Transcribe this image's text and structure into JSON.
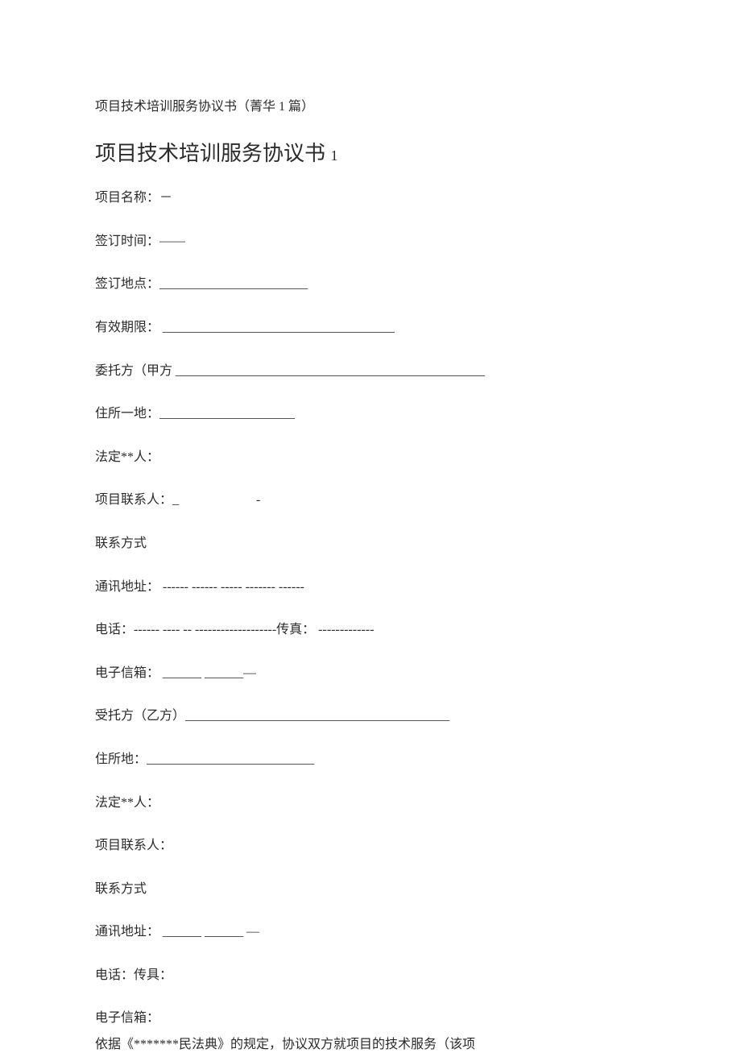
{
  "subtitle": "项目技术培训服务协议书（菁华 1 篇）",
  "title_main": "项目技术培训服务协议书 ",
  "title_num": "1",
  "fields": {
    "project_name": "项目名称：－",
    "sign_time": "签订时间：——",
    "sign_place": "签订地点：_______________________",
    "valid_period": "有效期限： ____________________________________",
    "party_a": "委托方（甲方 ________________________________________________",
    "residence_a": "住所一地：_____________________",
    "legal_a": "法定**人：",
    "contact_a": "项目联系人：_　　　　　　-",
    "contact_method_a": "联系方式",
    "address_a": "通讯地址： ------ ------ ----- ------- ------",
    "phone_a": "电话：------ ---- -- -------------------传真： -------------",
    "email_a": "电子信箱： ______ ______—",
    "party_b": "受托方（乙方）_________________________________________",
    "residence_b": "住所地：__________________________",
    "legal_b": "法定**人：",
    "contact_b": "项目联系人：",
    "contact_method_b": "联系方式",
    "address_b": "通讯地址： ______ ______ —",
    "phone_b": "电话：传具：",
    "email_b": "电子信箱："
  },
  "body_text": "依据《*******民法典》的规定，协议双方就项目的技术服务（该项"
}
